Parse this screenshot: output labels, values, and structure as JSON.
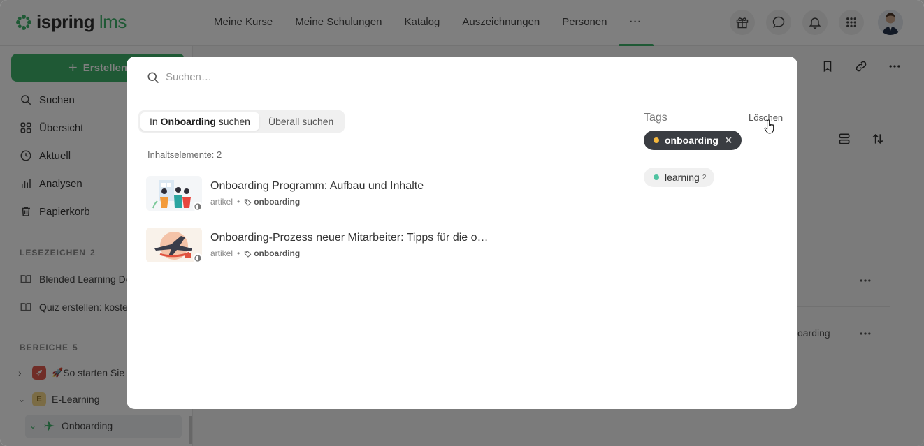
{
  "app": {
    "logo_main": "ispring",
    "logo_accent": "lms",
    "nav": [
      "Meine Kurse",
      "Meine Schulungen",
      "Katalog",
      "Auszeichnungen",
      "Personen"
    ],
    "nav_more": "···"
  },
  "sidebar": {
    "create_label": "Erstellen",
    "items": [
      "Suchen",
      "Übersicht",
      "Aktuell",
      "Analysen",
      "Papierkorb"
    ],
    "bookmarks_head": "LESEZEICHEN",
    "bookmarks_count": "2",
    "bookmarks": [
      "Blended Learning De",
      "Quiz erstellen: koste"
    ],
    "areas_head": "BEREICHE",
    "areas_count": "5",
    "tree": {
      "item1": "So starten Sie",
      "item2": "E-Learning",
      "item2_badge": "E",
      "item3": "Onboarding"
    }
  },
  "content": {
    "partial_tag": "oarding"
  },
  "modal": {
    "search_placeholder": "Suchen…",
    "scope_prefix": "In",
    "scope_name": "Onboarding",
    "scope_suffix": "suchen",
    "scope_all": "Überall suchen",
    "count_label": "Inhaltselemente: 2",
    "results": [
      {
        "title": "Onboarding Programm: Aufbau und Inhalte",
        "type": "artikel",
        "tag": "onboarding"
      },
      {
        "title": "Onboarding-Prozess neuer Mitarbeiter: Tipps für die o…",
        "type": "artikel",
        "tag": "onboarding"
      }
    ],
    "meta_sep": "•",
    "tags_title": "Tags",
    "clear_label": "Löschen",
    "tags": [
      {
        "label": "onboarding",
        "color": "#f5b83d",
        "selected": true
      },
      {
        "label": "learning",
        "count": "2",
        "color": "#4fc3a1",
        "selected": false
      }
    ]
  },
  "colors": {
    "accent": "#3fb36b",
    "chip_dark": "#3a3d42"
  }
}
